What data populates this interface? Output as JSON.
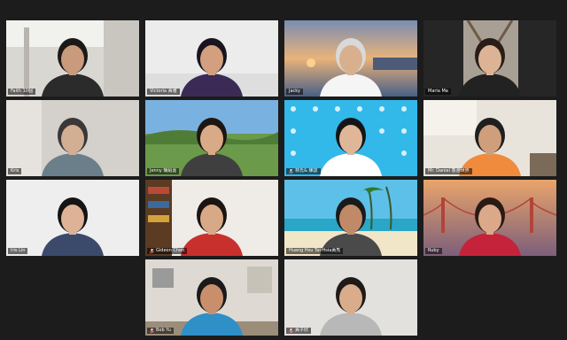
{
  "meeting": {
    "participants": [
      {
        "name": "Faith 10個",
        "muted": false,
        "scene": "office",
        "shirt": "#2b2b2b",
        "hair": "#1c1a18",
        "skin": "#c99a7c"
      },
      {
        "name": "Victoria 黃雅",
        "muted": false,
        "scene": "plain",
        "shirt": "#3b2a55",
        "hair": "#1a1420",
        "skin": "#d2a07f"
      },
      {
        "name": "Jacky",
        "muted": false,
        "scene": "sunset",
        "shirt": "#f5f5f5",
        "hair": "#d9d9d9",
        "skin": "#d9b08e"
      },
      {
        "name": "Maria Ma",
        "muted": false,
        "scene": "tree",
        "shirt": "#222222",
        "hair": "#2a1d18",
        "skin": "#dcb495"
      },
      {
        "name": "Kris",
        "muted": false,
        "scene": "wall",
        "shirt": "#6b7f8a",
        "hair": "#3a3838",
        "skin": "#d2ae93"
      },
      {
        "name": "Jenny 簡紹嘉",
        "muted": false,
        "scene": "hills",
        "shirt": "#3f3f3f",
        "hair": "#1e1612",
        "skin": "#d8aa88"
      },
      {
        "name": "林氏& 陳誌",
        "muted": true,
        "scene": "pattern",
        "shirt": "#ffffff",
        "hair": "#151515",
        "skin": "#e0b699"
      },
      {
        "name": "Mr. Daniel 香港世界",
        "muted": false,
        "scene": "kitchen",
        "shirt": "#f08a3c",
        "hair": "#1f1f1f",
        "skin": "#cf9e7c"
      },
      {
        "name": "Iris Lin",
        "muted": false,
        "scene": "plain2",
        "shirt": "#3b4a6b",
        "hair": "#141414",
        "skin": "#ddb296"
      },
      {
        "name": "Gideon Chen",
        "muted": true,
        "scene": "bookshelf",
        "shirt": "#c8302e",
        "hair": "#1b1410",
        "skin": "#d8a987"
      },
      {
        "name": "Huang Hsu Tai-Hsia黃秀",
        "muted": false,
        "scene": "beach",
        "shirt": "#4a4a4a",
        "hair": "#1a1a1a",
        "skin": "#c08a69"
      },
      {
        "name": "Ruby",
        "muted": false,
        "scene": "bridge",
        "shirt": "#c5233b",
        "hair": "#2a1a14",
        "skin": "#dba88a"
      },
      {
        "name": "Bob Yu",
        "muted": true,
        "scene": "room",
        "shirt": "#2f8fc7",
        "hair": "#1a1a1a",
        "skin": "#c98f6d"
      },
      {
        "name": "黃子欣",
        "muted": true,
        "scene": "plain3",
        "shirt": "#b8b8b8",
        "hair": "#1f1a17",
        "skin": "#d9ac8c"
      }
    ],
    "active_speaker": "Ruby"
  }
}
